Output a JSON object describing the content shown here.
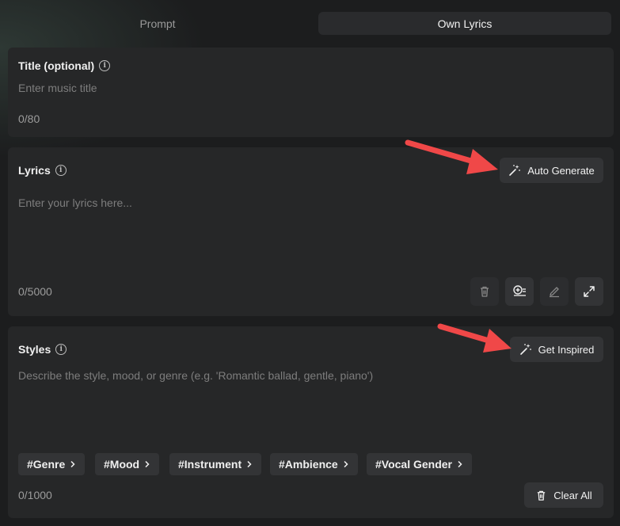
{
  "tabs": [
    {
      "label": "Prompt",
      "active": false
    },
    {
      "label": "Own Lyrics",
      "active": true
    }
  ],
  "title_section": {
    "label": "Title (optional)",
    "placeholder": "Enter music title",
    "counter": "0/80"
  },
  "lyrics_section": {
    "label": "Lyrics",
    "auto_generate_label": "Auto Generate",
    "placeholder": "Enter your lyrics here...",
    "counter": "0/5000",
    "tools": [
      "trash-icon",
      "add-section-icon",
      "pencil-icon",
      "expand-icon"
    ]
  },
  "styles_section": {
    "label": "Styles",
    "get_inspired_label": "Get Inspired",
    "placeholder": "Describe the style, mood, or genre (e.g. 'Romantic ballad, gentle, piano')",
    "tags": [
      "#Genre",
      "#Mood",
      "#Instrument",
      "#Ambience",
      "#Vocal Gender"
    ],
    "counter": "0/1000",
    "clear_all_label": "Clear All"
  },
  "colors": {
    "background": "#1c1d1e",
    "panel": "#262728",
    "button": "#333436",
    "annotation_arrow": "#f04848"
  }
}
